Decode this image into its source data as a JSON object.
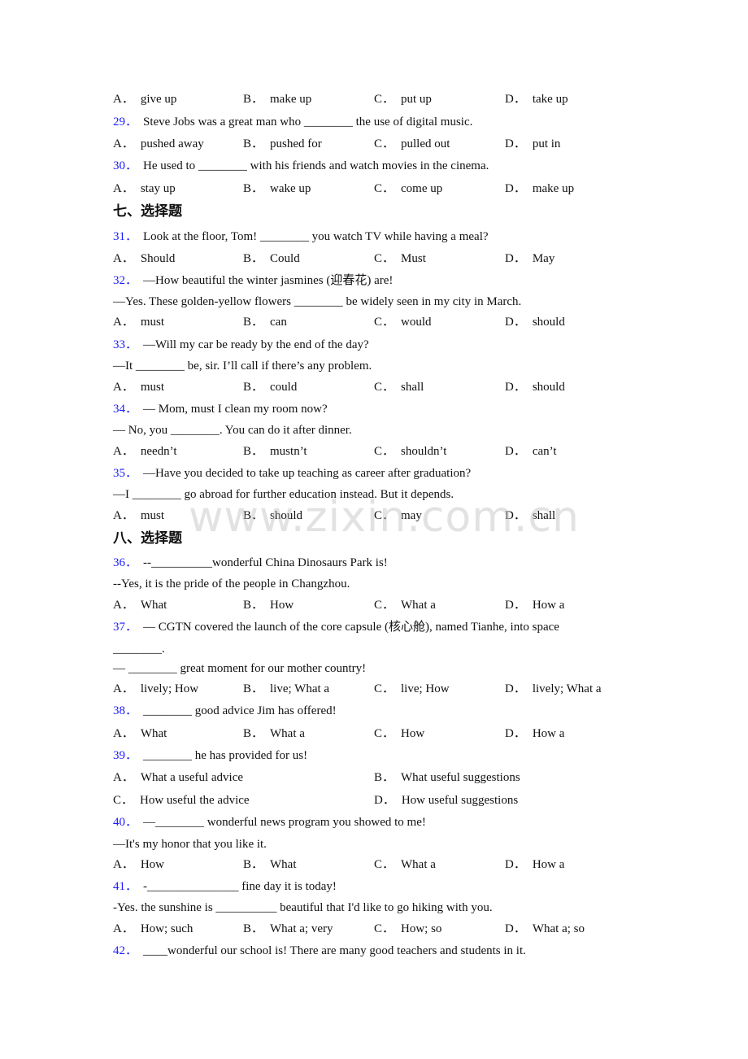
{
  "rows": [
    {
      "type": "options4",
      "y": 0,
      "opts": [
        [
          "A．",
          "give up"
        ],
        [
          "B．",
          "make up"
        ],
        [
          "C．",
          "put up"
        ],
        [
          "D．",
          "take up"
        ]
      ]
    },
    {
      "type": "question",
      "num": "29．",
      "text": "Steve Jobs was a great man who ________ the use of digital music."
    },
    {
      "type": "options4",
      "opts": [
        [
          "A．",
          "pushed away"
        ],
        [
          "B．",
          "pushed for"
        ],
        [
          "C．",
          "pulled out"
        ],
        [
          "D．",
          "put in"
        ]
      ]
    },
    {
      "type": "question",
      "num": "30．",
      "text": "He used to ________ with his friends and watch movies in the cinema."
    },
    {
      "type": "options4",
      "opts": [
        [
          "A．",
          "stay up"
        ],
        [
          "B．",
          "wake up"
        ],
        [
          "C．",
          "come up"
        ],
        [
          "D．",
          "make up"
        ]
      ]
    },
    {
      "type": "heading",
      "text": "七、选择题"
    },
    {
      "type": "question",
      "num": "31．",
      "text": "Look at the floor, Tom! ________ you watch TV while having a meal?"
    },
    {
      "type": "options4",
      "opts": [
        [
          "A．",
          "Should"
        ],
        [
          "B．",
          "Could"
        ],
        [
          "C．",
          "Must"
        ],
        [
          "D．",
          "May"
        ]
      ]
    },
    {
      "type": "question",
      "num": "32．",
      "text": "—How beautiful the winter jasmines (迎春花) are!"
    },
    {
      "type": "text",
      "text": "—Yes. These golden-yellow flowers ________ be widely seen in my city in March."
    },
    {
      "type": "options4",
      "opts": [
        [
          "A．",
          "must"
        ],
        [
          "B．",
          "can"
        ],
        [
          "C．",
          "would"
        ],
        [
          "D．",
          "should"
        ]
      ]
    },
    {
      "type": "question",
      "num": "33．",
      "text": "—Will my car be ready by the end of the day?"
    },
    {
      "type": "text",
      "text": "—It ________ be, sir. I’ll call if there’s any problem."
    },
    {
      "type": "options4",
      "opts": [
        [
          "A．",
          "must"
        ],
        [
          "B．",
          "could"
        ],
        [
          "C．",
          "shall"
        ],
        [
          "D．",
          "should"
        ]
      ]
    },
    {
      "type": "question",
      "num": "34．",
      "text": "— Mom, must I clean my room now?"
    },
    {
      "type": "text",
      "text": "— No, you ________. You can do it after dinner."
    },
    {
      "type": "options4",
      "opts": [
        [
          "A．",
          "needn’t"
        ],
        [
          "B．",
          "mustn’t"
        ],
        [
          "C．",
          "shouldn’t"
        ],
        [
          "D．",
          "can’t"
        ]
      ]
    },
    {
      "type": "question",
      "num": "35．",
      "text": "—Have you decided to take up teaching as career after graduation?"
    },
    {
      "type": "text",
      "text": "—I ________ go abroad for further education instead. But it depends."
    },
    {
      "type": "options4",
      "opts": [
        [
          "A．",
          "must"
        ],
        [
          "B．",
          "should"
        ],
        [
          "C．",
          "may"
        ],
        [
          "D．",
          "shall"
        ]
      ]
    },
    {
      "type": "heading",
      "text": "八、选择题"
    },
    {
      "type": "question",
      "num": "36．",
      "text": "--__________wonderful China Dinosaurs Park is!"
    },
    {
      "type": "text",
      "text": "--Yes, it is the pride of the people in Changzhou."
    },
    {
      "type": "options4",
      "opts": [
        [
          "A．",
          "What"
        ],
        [
          "B．",
          "How"
        ],
        [
          "C．",
          "What a"
        ],
        [
          "D．",
          "How a"
        ]
      ]
    },
    {
      "type": "question",
      "num": "37．",
      "text": "— CGTN covered the launch of the core capsule (核心舱), named Tianhe, into space"
    },
    {
      "type": "text",
      "text": "________."
    },
    {
      "type": "text",
      "text": "— ________ great moment for our mother country!"
    },
    {
      "type": "options4",
      "opts": [
        [
          "A．",
          "lively; How"
        ],
        [
          "B．",
          "live; What a"
        ],
        [
          "C．",
          "live; How"
        ],
        [
          "D．",
          "lively; What a"
        ]
      ]
    },
    {
      "type": "question",
      "num": "38．",
      "text": "________ good advice Jim has offered!"
    },
    {
      "type": "options4",
      "opts": [
        [
          "A．",
          "What"
        ],
        [
          "B．",
          "What a"
        ],
        [
          "C．",
          "How"
        ],
        [
          "D．",
          "How a"
        ]
      ]
    },
    {
      "type": "question",
      "num": "39．",
      "text": "________ he has provided for us!"
    },
    {
      "type": "options2",
      "opts": [
        [
          "A．",
          "What a useful advice"
        ],
        [
          "B．",
          "What useful suggestions"
        ]
      ]
    },
    {
      "type": "options2",
      "opts": [
        [
          "C．",
          "How useful the advice"
        ],
        [
          "D．",
          "How useful suggestions"
        ]
      ]
    },
    {
      "type": "question",
      "num": "40．",
      "text": "—________ wonderful news program you showed to me!"
    },
    {
      "type": "text",
      "text": "—It's my honor that you like it."
    },
    {
      "type": "options4",
      "opts": [
        [
          "A．",
          "How"
        ],
        [
          "B．",
          "What"
        ],
        [
          "C．",
          "What a"
        ],
        [
          "D．",
          "How a"
        ]
      ]
    },
    {
      "type": "question",
      "num": "41．",
      "text": "-_______________ fine day it is today!"
    },
    {
      "type": "text",
      "text": "-Yes. the sunshine is __________ beautiful that I'd like to go hiking with you."
    },
    {
      "type": "options4",
      "opts": [
        [
          "A．",
          "How; such"
        ],
        [
          "B．",
          "What a; very"
        ],
        [
          "C．",
          "How; so"
        ],
        [
          "D．",
          "What a; so"
        ]
      ]
    },
    {
      "type": "question",
      "num": "42．",
      "text": "____wonderful our school is! There are many good teachers and students in it."
    }
  ],
  "watermark": "www.zixin.com.cn",
  "colors": {
    "question_number": "#1a1aff",
    "text": "#111111",
    "watermark": "#bebebe"
  }
}
